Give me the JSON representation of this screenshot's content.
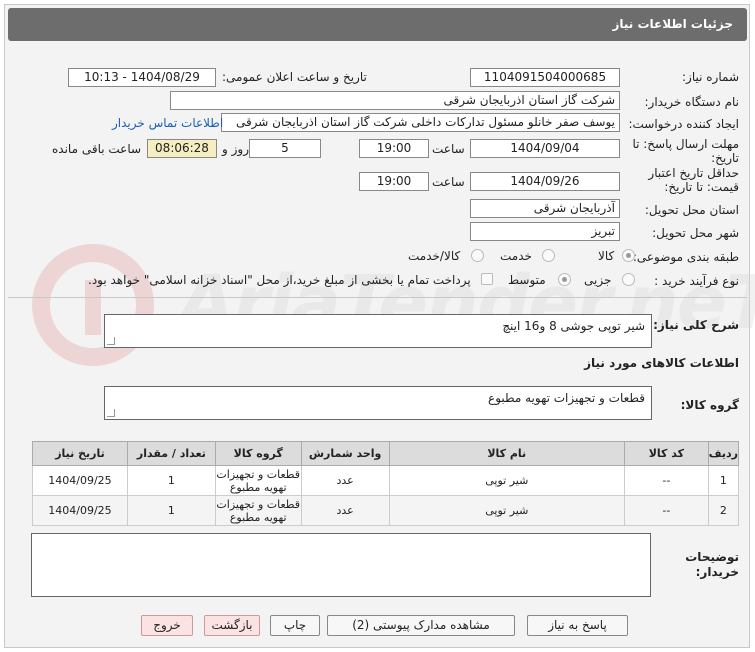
{
  "header": {
    "title": "جزئیات اطلاعات نیاز"
  },
  "form": {
    "need_number_label": "شماره نیاز:",
    "need_number": "1104091504000685",
    "announce_label": "تاریخ و ساعت اعلان عمومی:",
    "announce_value": "1404/08/29 - 10:13",
    "buyer_org_label": "نام دستگاه خریدار:",
    "buyer_org": "شرکت گاز استان اذربایجان شرقی",
    "creator_label": "ایجاد کننده درخواست:",
    "creator": "یوسف صفر خانلو  مسئول تدارکات داخلی  شرکت گاز استان اذربایجان شرقی",
    "contact_link": "اطلاعات تماس خریدار",
    "deadline_label": "مهلت ارسال پاسخ: تا تاریخ:",
    "deadline_date": "1404/09/04",
    "time_label": "ساعت",
    "deadline_time": "19:00",
    "days_count": "5",
    "days_and_label": "روز و",
    "remaining_time": "08:06:28",
    "remaining_label": "ساعت باقی مانده",
    "validity_label": "حداقل تاریخ اعتبار قیمت: تا تاریخ:",
    "validity_date": "1404/09/26",
    "validity_time": "19:00",
    "province_label": "استان محل تحویل:",
    "province": "آذربایجان شرقی",
    "city_label": "شهر محل تحویل:",
    "city": "تبریز",
    "category_label": "طبقه بندی موضوعی:",
    "category_options": [
      "کالا",
      "خدمت",
      "کالا/خدمت"
    ],
    "category_selected": "کالا",
    "process_label": "نوع فرآیند خرید :",
    "process_options": [
      "جزیی",
      "متوسط"
    ],
    "process_selected": "متوسط",
    "payment_note": "پرداخت تمام یا بخشی از مبلغ خرید،از محل \"اسناد خزانه اسلامی\" خواهد بود."
  },
  "summary": {
    "label": "شرح کلی نیاز:",
    "text": "شیر توپی جوشی 8 و16 اینچ"
  },
  "goods": {
    "section_title": "اطلاعات کالاهای مورد نیاز",
    "group_label": "گروه کالا:",
    "group_value": "قطعات و تجهیزات تهویه مطبوع"
  },
  "table": {
    "columns": [
      "ردیف",
      "کد کالا",
      "نام کالا",
      "واحد شمارش",
      "گروه کالا",
      "تعداد / مقدار",
      "تاریخ نیاز"
    ],
    "rows": [
      [
        "1",
        "--",
        "شیر توپی",
        "عدد",
        "قطعات و تجهیزات تهویه مطبوع",
        "1",
        "1404/09/25"
      ],
      [
        "2",
        "--",
        "شیر توپی",
        "عدد",
        "قطعات و تجهیزات تهویه مطبوع",
        "1",
        "1404/09/25"
      ]
    ]
  },
  "buyer_notes": {
    "label": "توضیحات خریدار:",
    "text": ""
  },
  "buttons": {
    "reply": "پاسخ به نیاز",
    "attachments": "مشاهده مدارک پیوستی (2)",
    "print": "چاپ",
    "back": "بازگشت",
    "exit": "خروج"
  },
  "watermark": {
    "text": "AriaTender.neT"
  },
  "colors": {
    "titlebar": "#6d6d6d",
    "link": "#1a5fb4",
    "remaining_bg": "#f5eec0",
    "exit_bg": "#fbe3e3"
  }
}
